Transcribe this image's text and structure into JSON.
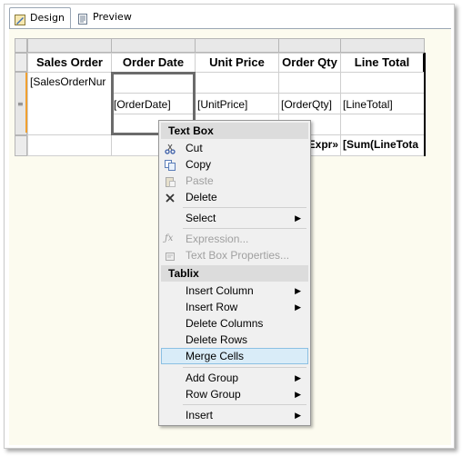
{
  "tabs": [
    {
      "label": "Design",
      "icon": "design-icon"
    },
    {
      "label": "Preview",
      "icon": "preview-icon"
    }
  ],
  "table": {
    "headers": [
      "Sales Order",
      "Order Date",
      "Unit Price",
      "Order Qty",
      "Line Total"
    ],
    "group_row": [
      "[SalesOrderNur",
      "",
      "",
      "",
      ""
    ],
    "detail_row": [
      "",
      "[OrderDate]",
      "[UnitPrice]",
      "[OrderQty]",
      "[LineTotal]"
    ],
    "footer_row": [
      "",
      "",
      "",
      "Expr»",
      "[Sum(LineTota"
    ]
  },
  "context_menu": {
    "section_textbox": "Text Box",
    "cut": "Cut",
    "copy": "Copy",
    "paste": "Paste",
    "delete": "Delete",
    "select": "Select",
    "expression": "Expression...",
    "textbox_properties": "Text Box Properties...",
    "section_tablix": "Tablix",
    "insert_column": "Insert Column",
    "insert_row": "Insert Row",
    "delete_columns": "Delete Columns",
    "delete_rows": "Delete Rows",
    "merge_cells": "Merge Cells",
    "add_group": "Add Group",
    "row_group": "Row Group",
    "insert": "Insert",
    "submenu_arrow": "▶"
  },
  "colors": {
    "highlight": "#d9ecf8",
    "selection_handle": "#f0a030",
    "canvas": "#fcfbef"
  }
}
